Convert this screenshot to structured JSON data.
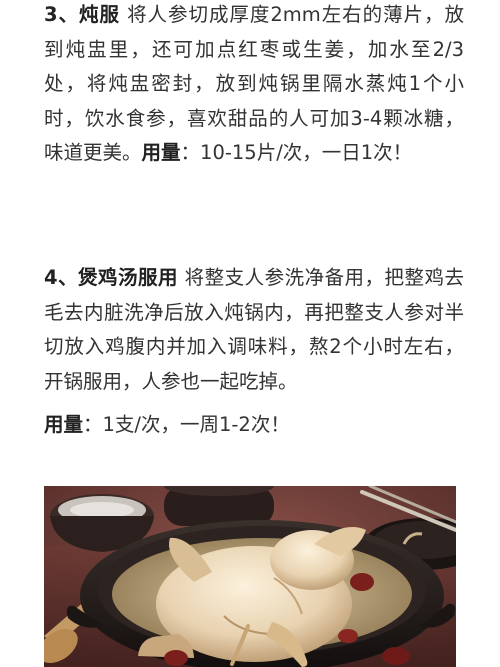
{
  "section3": {
    "number": "3、",
    "heading": "炖服",
    "body": " 将人参切成厚度2mm左右的薄片，放到炖盅里，还可加点红枣或生姜，加水至2/3处，将炖盅密封，放到炖锅里隔水蒸炖1个小时，饮水食参，喜欢甜品的人可加3-4颗冰糖，味道更美。",
    "dosage_label": "用量",
    "dosage_text": "：10-15片/次，一日1次！"
  },
  "section4": {
    "number": "4、",
    "heading": "煲鸡汤服用",
    "body": " 将整支人参洗净备用，把整鸡去毛去内脏洗净后放入炖锅内，再把整支人参对半切放入鸡腹内并加入调味料，熬2个小时左右，开锅服用，人参也一起吃掉。",
    "dosage_label": "用量",
    "dosage_text": "：1支/次，一周1-2次！"
  },
  "photo": {
    "subject": "chicken-soup-photo",
    "colors": {
      "background": "#5a302c",
      "pot": "#1c1716",
      "chicken": "#e8d2b0",
      "dates": "#7a1f1c"
    }
  }
}
